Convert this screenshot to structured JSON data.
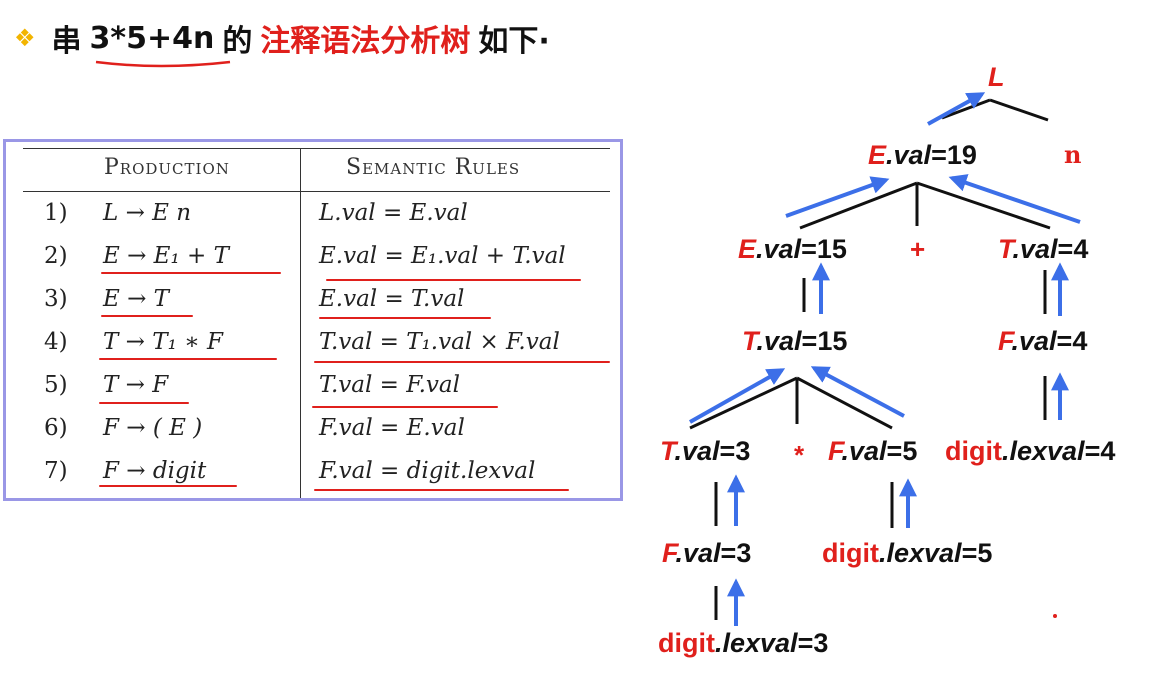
{
  "title": {
    "bullet_icon": "diamond-bullet-icon",
    "part1": "串",
    "expr": "3*5+4n",
    "part2": "的",
    "highlight": "注释语法分析树",
    "part3": "如下·"
  },
  "table": {
    "headers": {
      "production": "Production",
      "semantic": "Semantic   Rules"
    },
    "rows": [
      {
        "num": "1)",
        "production": "L → E n",
        "rule": "L.val = E.val"
      },
      {
        "num": "2)",
        "production": "E → E₁  +  T",
        "rule": "E.val = E₁.val + T.val"
      },
      {
        "num": "3)",
        "production": "E → T",
        "rule": "E.val = T.val"
      },
      {
        "num": "4)",
        "production": "T → T₁  ∗  F",
        "rule": "T.val = T₁.val × F.val"
      },
      {
        "num": "5)",
        "production": "T → F",
        "rule": "T.val = F.val"
      },
      {
        "num": "6)",
        "production": "F → ( E )",
        "rule": "F.val = E.val"
      },
      {
        "num": "7)",
        "production": "F → digit",
        "rule": "F.val = digit.lexval"
      }
    ]
  },
  "tree": {
    "nodes": {
      "root": {
        "sym": "L",
        "attr": ""
      },
      "e19": {
        "sym": "E",
        "attr": ".val",
        "value": "=19"
      },
      "n": {
        "sym": "n",
        "attr": ""
      },
      "e15": {
        "sym": "E",
        "attr": ".val",
        "value": "=15"
      },
      "plus": "+",
      "t4": {
        "sym": "T",
        "attr": ".val",
        "value": "=4"
      },
      "t15": {
        "sym": "T",
        "attr": ".val",
        "value": "=15"
      },
      "f4": {
        "sym": "F",
        "attr": ".val",
        "value": "=4"
      },
      "t3": {
        "sym": "T",
        "attr": ".val",
        "value": "=3"
      },
      "star": "*",
      "f5": {
        "sym": "F",
        "attr": ".val",
        "value": "=5"
      },
      "d4": {
        "sym": "digit",
        "attr": ".lexval",
        "value": "=4"
      },
      "f3": {
        "sym": "F",
        "attr": ".val",
        "value": "=3"
      },
      "d5": {
        "sym": "digit",
        "attr": ".lexval",
        "value": "=5"
      },
      "d3": {
        "sym": "digit",
        "attr": ".lexval",
        "value": "=3"
      }
    },
    "colors": {
      "symbol": "#e0201c",
      "arrow": "#3c6fe8",
      "edge": "#111111",
      "underline": "#e0201c"
    }
  }
}
